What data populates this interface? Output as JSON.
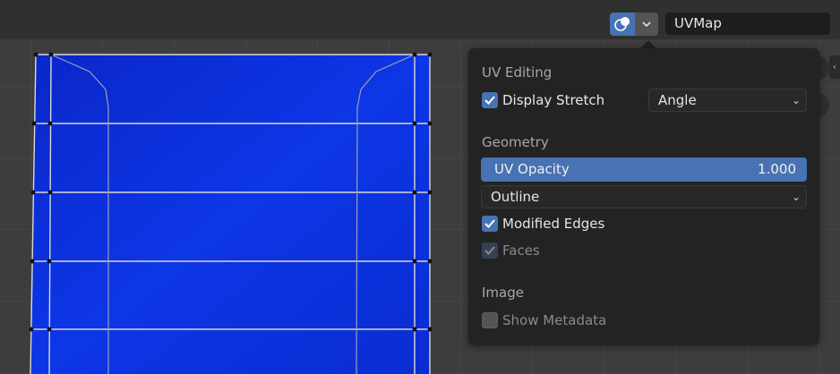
{
  "header": {
    "uv_map_name": "UVMap",
    "overlay_icon": "overlay-icon",
    "dropdown_icon": "chevron-down-icon"
  },
  "popover": {
    "uv_editing_title": "UV Editing",
    "display_stretch": {
      "label": "Display Stretch",
      "checked": true
    },
    "stretch_mode": "Angle",
    "geometry_title": "Geometry",
    "uv_opacity": {
      "label": "UV Opacity",
      "value": "1.000"
    },
    "edge_display": "Outline",
    "modified_edges": {
      "label": "Modified Edges",
      "checked": true
    },
    "faces": {
      "label": "Faces",
      "checked": true,
      "enabled": false
    },
    "image_title": "Image",
    "show_metadata": {
      "label": "Show Metadata",
      "checked": false
    }
  },
  "colors": {
    "accent": "#4772b3",
    "uv_fill": "#0a2fd6",
    "panel_bg": "#232323"
  }
}
